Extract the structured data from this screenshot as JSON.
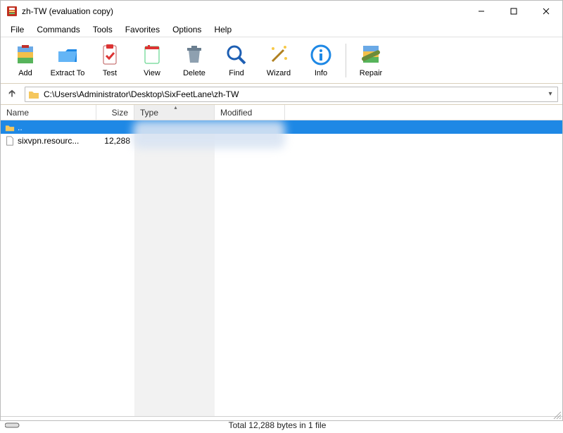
{
  "window": {
    "title": "zh-TW (evaluation copy)"
  },
  "menu": {
    "items": [
      "File",
      "Commands",
      "Tools",
      "Favorites",
      "Options",
      "Help"
    ]
  },
  "toolbar": {
    "buttons": [
      {
        "name": "add",
        "label": "Add"
      },
      {
        "name": "extract",
        "label": "Extract To"
      },
      {
        "name": "test",
        "label": "Test"
      },
      {
        "name": "view",
        "label": "View"
      },
      {
        "name": "delete",
        "label": "Delete"
      },
      {
        "name": "find",
        "label": "Find"
      },
      {
        "name": "wizard",
        "label": "Wizard"
      },
      {
        "name": "info",
        "label": "Info"
      },
      {
        "name": "repair",
        "label": "Repair"
      }
    ]
  },
  "path": {
    "value": "C:\\Users\\Administrator\\Desktop\\SixFeetLane\\zh-TW"
  },
  "columns": {
    "name": "Name",
    "size": "Size",
    "type": "Type",
    "modified": "Modified"
  },
  "rows": [
    {
      "name": "..",
      "size": "",
      "selected": true
    },
    {
      "name": "sixvpn.resourc...",
      "size": "12,288",
      "selected": false
    }
  ],
  "status": {
    "summary": "Total 12,288 bytes in 1 file"
  }
}
